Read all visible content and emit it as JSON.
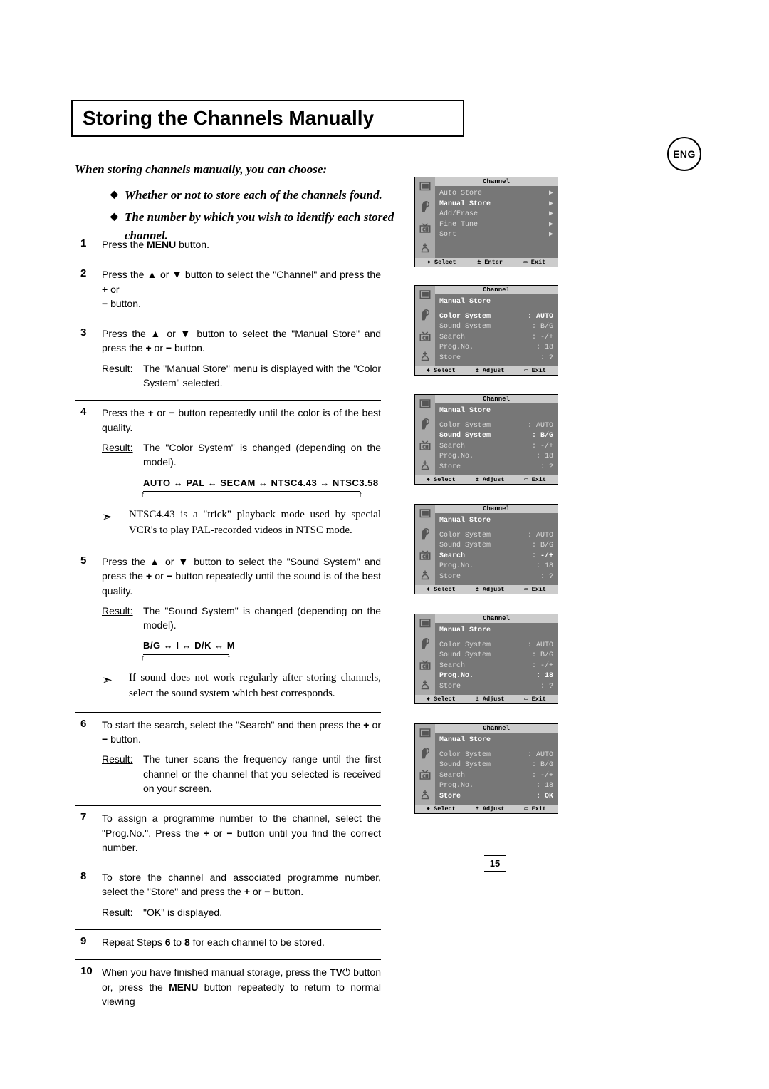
{
  "title": "Storing the Channels Manually",
  "lang_badge": "ENG",
  "page_number": "15",
  "intro": {
    "lead": "When storing channels manually, you can choose:",
    "b1": "Whether or not to store each of the channels found.",
    "b2": "The number by which you wish to identify each stored channel."
  },
  "steps": {
    "s1": {
      "n": "1",
      "t": "Press the <b>MENU</b> button."
    },
    "s2": {
      "n": "2",
      "t": "Press the ▲ or ▼ button to select the \"Channel\" and press the <b>+</b> or<br><b>−</b> button."
    },
    "s3": {
      "n": "3",
      "t": "Press the ▲ or ▼ button to select the \"Manual Store\" and press the <b>+</b> or <b>−</b> button.",
      "r": "The \"Manual Store\" menu is displayed with the \"Color System\" selected."
    },
    "s4": {
      "n": "4",
      "t": "Press the <b>+</b> or <b>−</b> button repeatedly until the color is of the best quality.",
      "r": "The \"Color System\" is changed (depending on the model).",
      "seq": "AUTO ↔ PAL ↔ SECAM ↔ NTSC4.43 ↔ NTSC3.58",
      "note": "NTSC4.43 is a \"trick\" playback mode used by special VCR's to play PAL-recorded videos in NTSC mode."
    },
    "s5": {
      "n": "5",
      "t": "Press the ▲ or ▼ button to select the \"Sound System\" and press the <b>+</b> or <b>−</b> button repeatedly until the sound is of the best quality.",
      "r": "The \"Sound System\" is changed (depending on the model).",
      "seq": "B/G ↔ I ↔ D/K ↔ M",
      "note": "If sound does not work regularly after storing channels, select the sound system which best corresponds."
    },
    "s6": {
      "n": "6",
      "t": "To start the search, select the \"Search\" and then press the <b>+</b> or <b>−</b> button.",
      "r": "The tuner scans the frequency range until the first channel or the channel that you selected is received on your screen."
    },
    "s7": {
      "n": "7",
      "t": "To assign a programme number to the channel, select the \"Prog.No.\". Press the <b>+</b> or <b>−</b> button until you find the correct number."
    },
    "s8": {
      "n": "8",
      "t": "To store the channel and associated programme number, select the \"Store\" and press the <b>+</b> or <b>−</b> button.",
      "r": "\"OK\" is displayed."
    },
    "s9": {
      "n": "9",
      "t": "Repeat Steps <b>6</b> to <b>8</b> for each channel to be stored."
    },
    "s10": {
      "n": "10",
      "t": "When you have finished manual storage, press the <b>TV</b>⏻ button or, press the <b>MENU</b> button repeatedly to return to normal viewing"
    }
  },
  "result_label": "Result:",
  "osd": {
    "title": "Channel",
    "foot_select": "♦ Select",
    "foot_enter": "± Enter",
    "foot_adjust": "± Adjust",
    "foot_exit": "▭ Exit",
    "menu1": {
      "r1_k": "Auto Store",
      "r1_v": "▶",
      "r2_k": "Manual Store",
      "r2_v": "▶",
      "r3_k": "Add/Erase",
      "r3_v": "▶",
      "r4_k": "Fine Tune",
      "r4_v": "▶",
      "r5_k": "Sort",
      "r5_v": "▶"
    },
    "ms_title": "Manual Store",
    "row_cs": "Color System",
    "row_ss": "Sound System",
    "row_search": "Search",
    "row_prog": "Prog.No.",
    "row_store": "Store",
    "v_auto": "AUTO",
    "v_bg": "B/G",
    "v_mp": "-/+",
    "v_18": "18",
    "v_q": "?",
    "v_ok": "OK"
  }
}
